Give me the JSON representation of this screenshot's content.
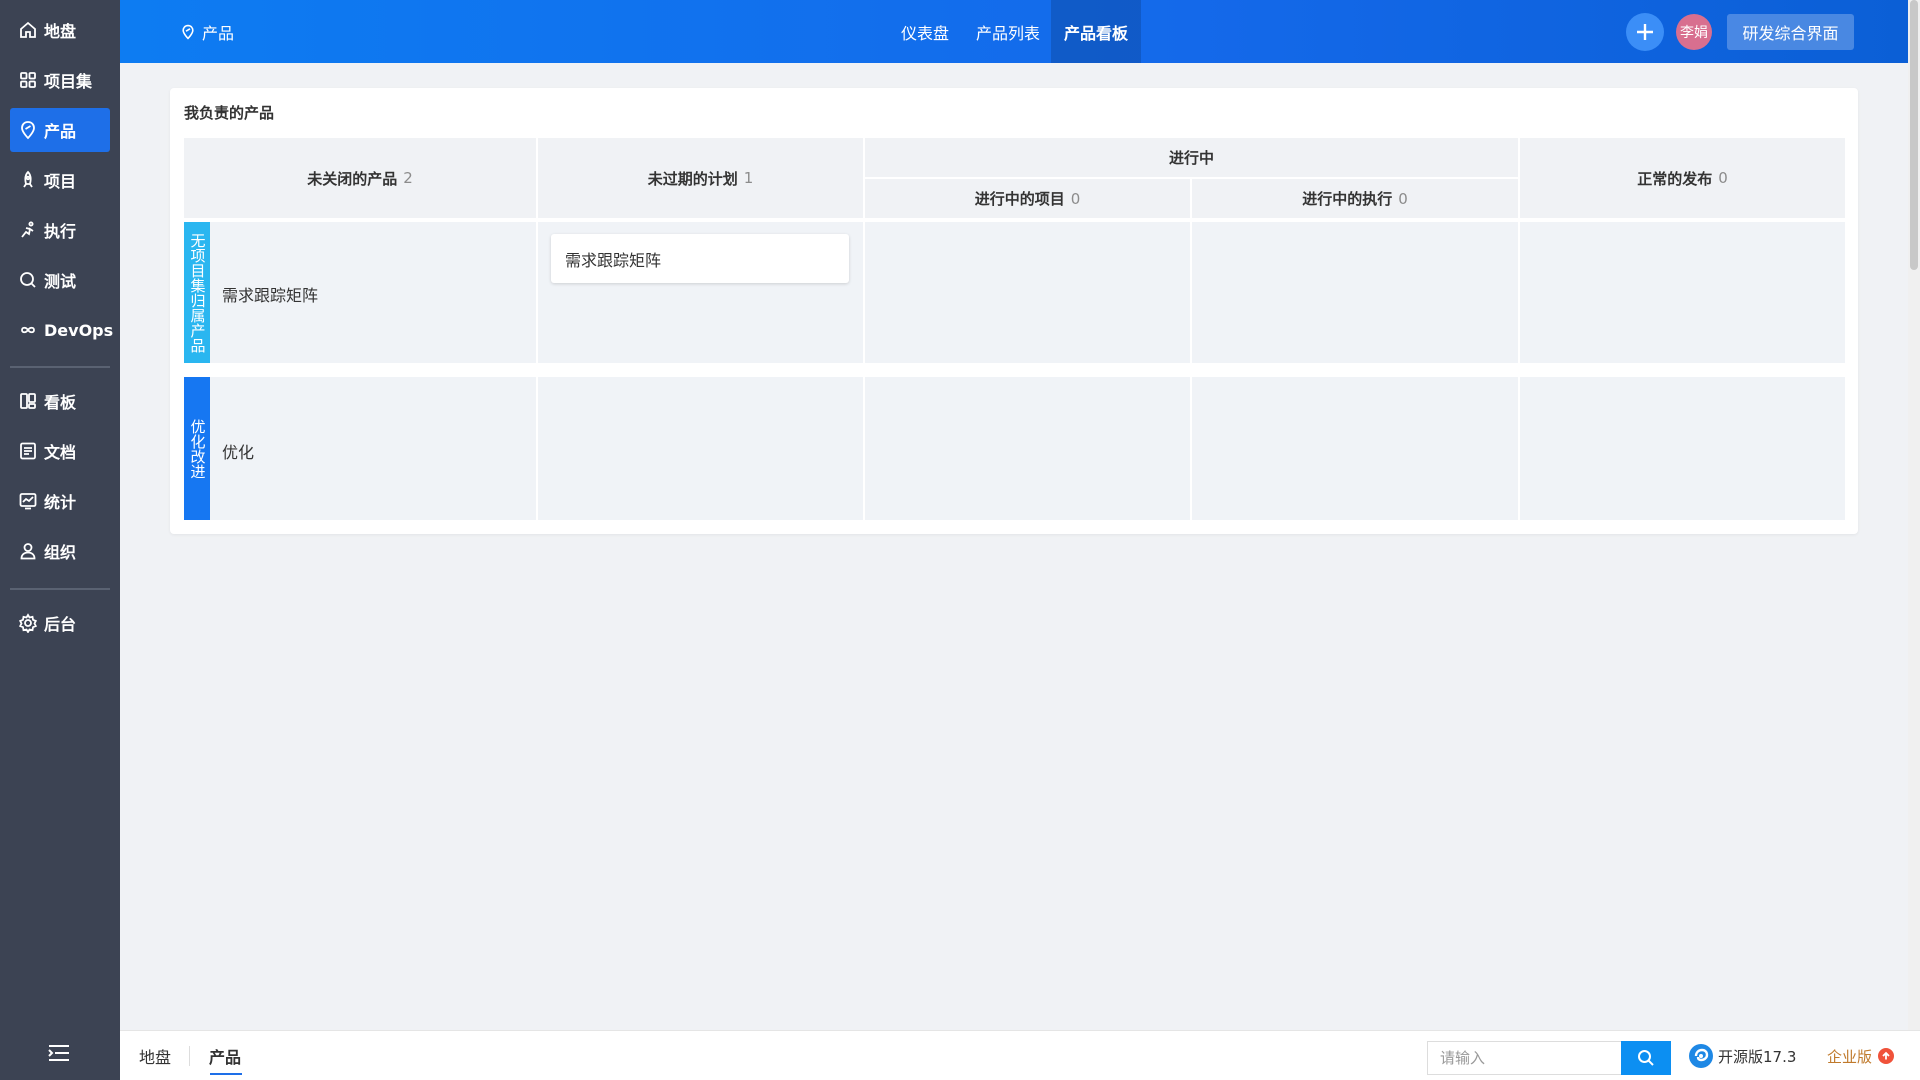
{
  "sidebar": {
    "items": [
      {
        "label": "地盘",
        "icon": "home-icon"
      },
      {
        "label": "项目集",
        "icon": "grid-icon"
      },
      {
        "label": "产品",
        "icon": "product-icon"
      },
      {
        "label": "项目",
        "icon": "rocket-icon"
      },
      {
        "label": "执行",
        "icon": "run-icon"
      },
      {
        "label": "测试",
        "icon": "test-icon"
      },
      {
        "label": "DevOps",
        "icon": "infinity-icon"
      },
      {
        "label": "看板",
        "icon": "kanban-icon"
      },
      {
        "label": "文档",
        "icon": "document-icon"
      },
      {
        "label": "统计",
        "icon": "chart-icon"
      },
      {
        "label": "组织",
        "icon": "user-icon"
      },
      {
        "label": "后台",
        "icon": "gear-icon"
      }
    ],
    "active": "产品"
  },
  "header": {
    "app_title": "产品",
    "tabs": [
      "仪表盘",
      "产品列表",
      "产品看板"
    ],
    "active_tab": "产品看板",
    "avatar_text": "李娟",
    "switch_label": "研发综合界面",
    "accent_color": "#1469ea"
  },
  "board": {
    "title": "我负责的产品",
    "columns": {
      "unclosed_products": {
        "label": "未关闭的产品",
        "count": "2"
      },
      "unexpired_plans": {
        "label": "未过期的计划",
        "count": "1"
      },
      "in_progress": {
        "label": "进行中"
      },
      "ongoing_projects": {
        "label": "进行中的项目",
        "count": "0"
      },
      "ongoing_executions": {
        "label": "进行中的执行",
        "count": "0"
      },
      "normal_releases": {
        "label": "正常的发布",
        "count": "0"
      }
    },
    "lines": [
      {
        "label": "无项目集归属产品",
        "color": "#2ab6f0",
        "product": "需求跟踪矩阵",
        "plans": [
          "需求跟踪矩阵"
        ]
      },
      {
        "label": "优化改进",
        "color": "#1677f2",
        "product": "优化",
        "plans": []
      }
    ]
  },
  "footer": {
    "breadcrumbs": [
      "地盘",
      "产品"
    ],
    "search_placeholder": "请输入",
    "version": "开源版17.3",
    "enterprise": "企业版"
  }
}
